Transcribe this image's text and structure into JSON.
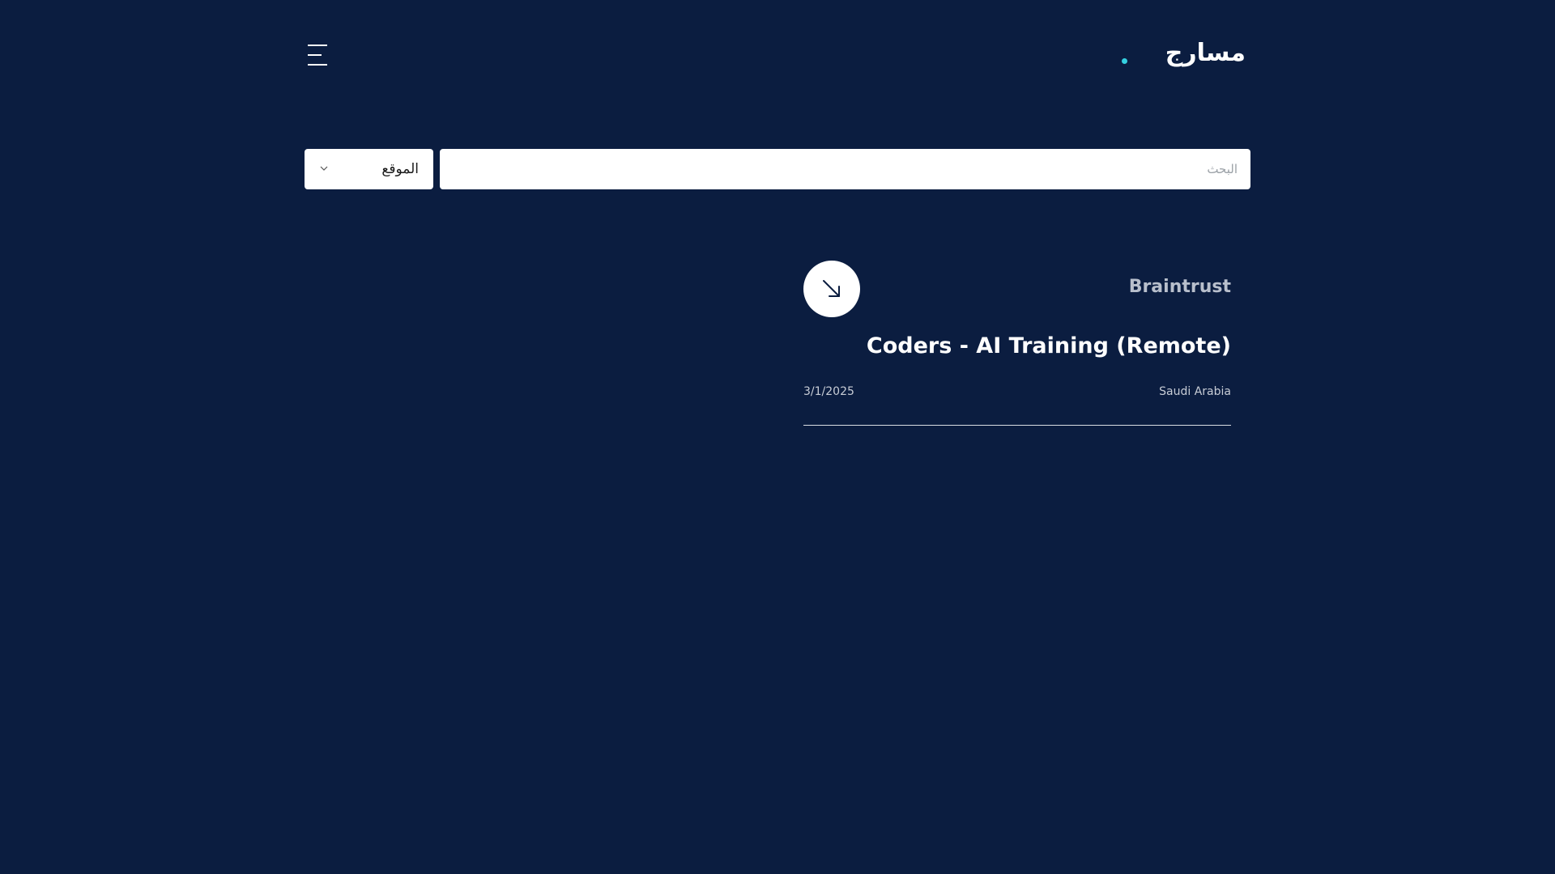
{
  "header": {
    "logo_text": "مسارج",
    "accent_color": "#35d0e0",
    "menu_icon": "hamburger-menu-icon"
  },
  "filters": {
    "location_label": "الموقع",
    "search_placeholder": "البحث",
    "search_value": ""
  },
  "jobs": [
    {
      "company": "Braintrust",
      "title": "Coders - AI Training (Remote)",
      "date": "3/1/2025",
      "location": "Saudi Arabia",
      "open_icon": "arrow-down-right-icon"
    }
  ],
  "colors": {
    "background": "#0b1d40",
    "card_text": "#ffffff",
    "muted_text": "#b8bfcc"
  }
}
